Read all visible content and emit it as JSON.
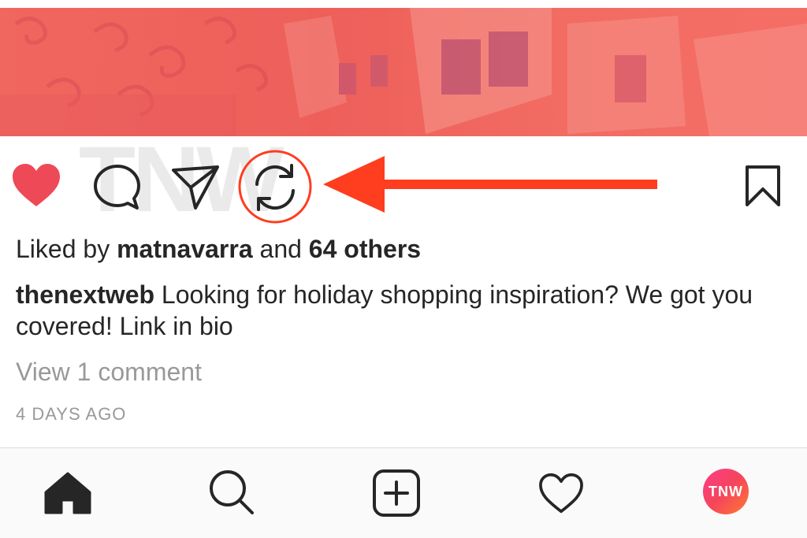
{
  "post": {
    "likes": {
      "prefix": "Liked by ",
      "user": "matnavarra",
      "conjunction": " and ",
      "others": "64 others"
    },
    "caption": {
      "user": "thenextweb",
      "text": " Looking for holiday shopping inspiration? We got you covered! Link in bio"
    },
    "view_comments": "View 1 comment",
    "timestamp": "4 DAYS AGO",
    "watermark": "TNW"
  },
  "actions": {
    "like": {
      "icon": "heart-filled-icon",
      "liked": true,
      "color": "#ed4956"
    },
    "comment": {
      "icon": "comment-icon"
    },
    "share": {
      "icon": "paper-plane-icon"
    },
    "repost": {
      "icon": "repost-icon",
      "highlighted": true
    },
    "save": {
      "icon": "bookmark-icon"
    }
  },
  "annotation": {
    "color": "#ff3d1f",
    "type": "arrow-pointing-left"
  },
  "tab_bar": {
    "tabs": [
      {
        "icon": "home-filled-icon",
        "active": true
      },
      {
        "icon": "search-icon"
      },
      {
        "icon": "plus-square-icon"
      },
      {
        "icon": "heart-outline-icon"
      },
      {
        "icon": "profile-avatar"
      }
    ],
    "avatar_text": "TNW"
  },
  "colors": {
    "image_tint": "#f0675f",
    "text": "#262626",
    "muted": "#999999",
    "like_red": "#ed4956",
    "annotation_red": "#ff3d1f"
  }
}
